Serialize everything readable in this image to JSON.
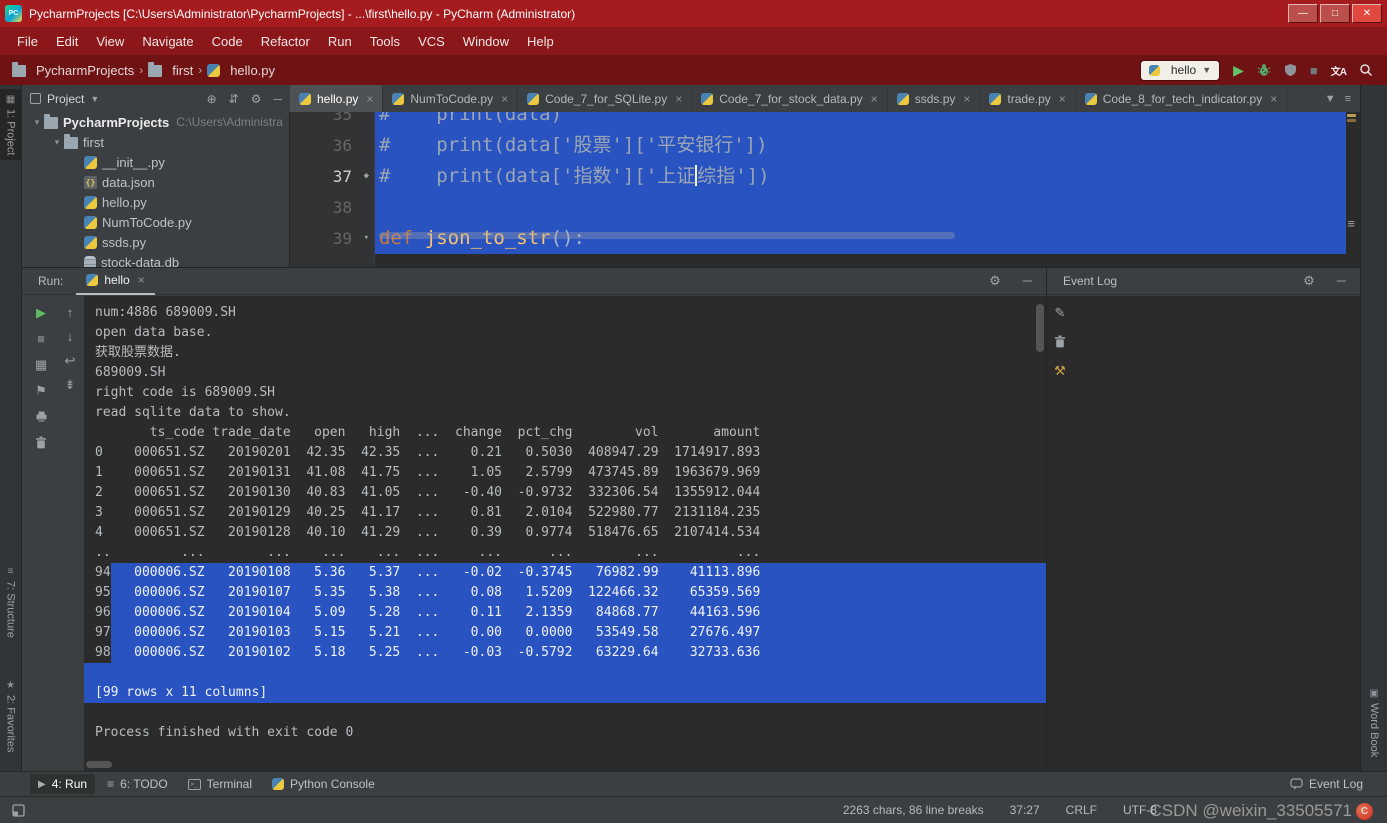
{
  "window": {
    "title": "PycharmProjects [C:\\Users\\Administrator\\PycharmProjects] - ...\\first\\hello.py - PyCharm (Administrator)"
  },
  "menu": {
    "items": [
      "File",
      "Edit",
      "View",
      "Navigate",
      "Code",
      "Refactor",
      "Run",
      "Tools",
      "VCS",
      "Window",
      "Help"
    ]
  },
  "toolbar": {
    "run_config": "hello"
  },
  "breadcrumbs": {
    "items": [
      "PycharmProjects",
      "first",
      "hello.py"
    ]
  },
  "tabs": {
    "items": [
      {
        "label": "hello.py",
        "active": true
      },
      {
        "label": "NumToCode.py"
      },
      {
        "label": "Code_7_for_SQLite.py"
      },
      {
        "label": "Code_7_for_stock_data.py"
      },
      {
        "label": "ssds.py"
      },
      {
        "label": "trade.py"
      },
      {
        "label": "Code_8_for_tech_indicator.py"
      }
    ]
  },
  "project_panel": {
    "title": "Project",
    "tree": [
      {
        "label": "PycharmProjects",
        "path": "C:\\Users\\Administra",
        "icon": "folder",
        "depth": 0,
        "arrow": true,
        "bold": true
      },
      {
        "label": "first",
        "icon": "folder",
        "depth": 1,
        "arrow": true
      },
      {
        "label": "__init__.py",
        "icon": "python",
        "depth": 2
      },
      {
        "label": "data.json",
        "icon": "json",
        "depth": 2
      },
      {
        "label": "hello.py",
        "icon": "python",
        "depth": 2
      },
      {
        "label": "NumToCode.py",
        "icon": "python",
        "depth": 2
      },
      {
        "label": "ssds.py",
        "icon": "python",
        "depth": 2
      },
      {
        "label": "stock-data.db",
        "icon": "db",
        "depth": 2
      }
    ]
  },
  "editor": {
    "lines": [
      {
        "num": "35",
        "tokens": [
          {
            "t": "#    print(data)",
            "c": "comment"
          }
        ]
      },
      {
        "num": "36",
        "tokens": [
          {
            "t": "#    print(data['股票']['平安银行'])",
            "c": "comment"
          }
        ]
      },
      {
        "num": "37",
        "current": true,
        "gutter_icon": "bookmark",
        "tokens": [
          {
            "t": "#    print(data['指数']['上证",
            "c": "comment"
          },
          {
            "caret": true
          },
          {
            "t": "综指'])",
            "c": "comment"
          }
        ]
      },
      {
        "num": "38",
        "tokens": []
      },
      {
        "num": "39",
        "gutter_icon": "fold",
        "tokens": [
          {
            "t": "def ",
            "c": "kw"
          },
          {
            "t": "json_to_str",
            "c": "fn"
          },
          {
            "t": "():",
            "c": "plain"
          }
        ]
      }
    ]
  },
  "run_panel": {
    "label": "Run:",
    "tab": "hello"
  },
  "console": {
    "lines": [
      {
        "t": "num:4886 689009.SH"
      },
      {
        "t": "open data base."
      },
      {
        "t": "获取股票数据."
      },
      {
        "t": "689009.SH"
      },
      {
        "t": "right code is 689009.SH"
      },
      {
        "t": "read sqlite data to show."
      },
      {
        "t": "       ts_code trade_date   open   high  ...  change  pct_chg        vol       amount"
      },
      {
        "t": "0    000651.SZ   20190201  42.35  42.35  ...    0.21   0.5030  408947.29  1714917.893"
      },
      {
        "t": "1    000651.SZ   20190131  41.08  41.75  ...    1.05   2.5799  473745.89  1963679.969"
      },
      {
        "t": "2    000651.SZ   20190130  40.83  41.05  ...   -0.40  -0.9732  332306.54  1355912.044"
      },
      {
        "t": "3    000651.SZ   20190129  40.25  41.17  ...    0.81   2.0104  522980.77  2131184.235"
      },
      {
        "t": "4    000651.SZ   20190128  40.10  41.29  ...    0.39   0.9774  518476.65  2107414.534"
      },
      {
        "t": "..         ...        ...    ...    ...  ...     ...      ...        ...          ..."
      },
      {
        "pre": "94",
        "t": "   000006.SZ   20190108   5.36   5.37  ...   -0.02  -0.3745   76982.99    41113.896",
        "sel": "part"
      },
      {
        "pre": "95",
        "t": "   000006.SZ   20190107   5.35   5.38  ...    0.08   1.5209  122466.32    65359.569",
        "sel": "part"
      },
      {
        "pre": "96",
        "t": "   000006.SZ   20190104   5.09   5.28  ...    0.11   2.1359   84868.77    44163.596",
        "sel": "part"
      },
      {
        "pre": "97",
        "t": "   000006.SZ   20190103   5.15   5.21  ...    0.00   0.0000   53549.58    27676.497",
        "sel": "part"
      },
      {
        "pre": "98",
        "t": "   000006.SZ   20190102   5.18   5.25  ...   -0.03  -0.5792   63229.64    32733.636",
        "sel": "part"
      },
      {
        "t": "",
        "sel": "full"
      },
      {
        "t": "[99 rows x 11 columns]",
        "sel": "full"
      },
      {
        "t": ""
      },
      {
        "t": "Process finished with exit code 0"
      }
    ]
  },
  "event_log": {
    "title": "Event Log"
  },
  "bottom_bar": {
    "run": "4: Run",
    "todo": "6: TODO",
    "terminal": "Terminal",
    "python_console": "Python Console",
    "event_log": "Event Log"
  },
  "status_bar": {
    "chars": "2263 chars, 86 line breaks",
    "position": "37:27",
    "line_ending": "CRLF",
    "encoding": "UTF-8"
  },
  "stripes": {
    "project": "1: Project",
    "structure": "7: Structure",
    "favorites": "2: Favorites",
    "word_book": "Word Book"
  },
  "watermark": {
    "text": "CSDN @weixin_33505571"
  }
}
